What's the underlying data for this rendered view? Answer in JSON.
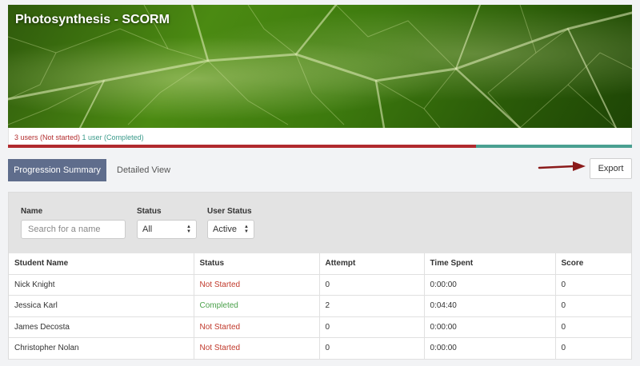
{
  "course": {
    "title": "Photosynthesis - SCORM"
  },
  "progress": {
    "not_started_text": "3 users (Not started)",
    "completed_text": "1 user (Completed)",
    "not_started_fraction": 0.75,
    "completed_fraction": 0.25,
    "not_started_color": "#b02a2e",
    "completed_color": "#4aa091"
  },
  "tabs": [
    {
      "label": "Progression Summary",
      "active": true
    },
    {
      "label": "Detailed View",
      "active": false
    }
  ],
  "export_label": "Export",
  "filters": {
    "name_label": "Name",
    "name_placeholder": "Search for a name",
    "status_label": "Status",
    "status_value": "All",
    "user_status_label": "User Status",
    "user_status_value": "Active"
  },
  "table": {
    "headers": [
      "Student Name",
      "Status",
      "Attempt",
      "Time Spent",
      "Score"
    ],
    "rows": [
      {
        "name": "Nick Knight",
        "status": "Not Started",
        "attempt": "0",
        "time": "0:00:00",
        "score": "0"
      },
      {
        "name": "Jessica Karl",
        "status": "Completed",
        "attempt": "2",
        "time": "0:04:40",
        "score": "0"
      },
      {
        "name": "James Decosta",
        "status": "Not Started",
        "attempt": "0",
        "time": "0:00:00",
        "score": "0"
      },
      {
        "name": "Christopher Nolan",
        "status": "Not Started",
        "attempt": "0",
        "time": "0:00:00",
        "score": "0"
      }
    ]
  }
}
